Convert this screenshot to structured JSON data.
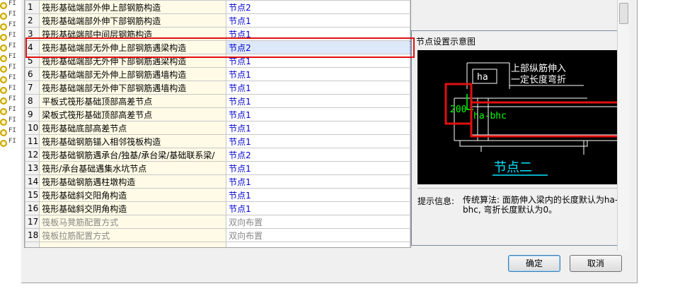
{
  "left_tree": {
    "items": [
      "FI",
      "FI",
      "FI",
      "FI",
      "FI",
      "FI",
      "FI",
      "FI",
      "FI",
      "FI",
      "FI",
      "FI",
      "FI",
      "FI"
    ]
  },
  "grid": {
    "rows": [
      {
        "num": "1",
        "name": "筏形基础端部外伸上部钢筋构造",
        "value": "节点2"
      },
      {
        "num": "2",
        "name": "筏形基础端部外伸下部钢筋构造",
        "value": "节点1"
      },
      {
        "num": "3",
        "name": "筏形基础端部中间层钢筋构造",
        "value": "节点1"
      },
      {
        "num": "4",
        "name": "筏形基础端部无外伸上部钢筋遇梁构造",
        "value": "节点2"
      },
      {
        "num": "5",
        "name": "筏形基础端部无外伸下部钢筋遇梁构造",
        "value": "节点1"
      },
      {
        "num": "6",
        "name": "筏形基础端部无外伸上部钢筋遇墙构造",
        "value": "节点1"
      },
      {
        "num": "7",
        "name": "筏形基础端部无外伸下部钢筋遇墙构造",
        "value": "节点1"
      },
      {
        "num": "8",
        "name": "平板式筏形基础顶部高差节点",
        "value": "节点1"
      },
      {
        "num": "9",
        "name": "梁板式筏形基础顶部高差节点",
        "value": "节点1"
      },
      {
        "num": "10",
        "name": "筏形基础底部高差节点",
        "value": "节点1"
      },
      {
        "num": "11",
        "name": "筏形基础钢筋锚入相邻筏板构造",
        "value": "节点1"
      },
      {
        "num": "12",
        "name": "筏形基础钢筋遇承台/独基/承台梁/基础联系梁/",
        "value": "节点2"
      },
      {
        "num": "13",
        "name": "筏形/承台基础遇集水坑节点",
        "value": "节点1"
      },
      {
        "num": "14",
        "name": "筏形基础钢筋遇柱墩构造",
        "value": "节点1"
      },
      {
        "num": "15",
        "name": "筏形基础斜交阳角构造",
        "value": "节点1"
      },
      {
        "num": "16",
        "name": "筏形基础斜交阴角构造",
        "value": "节点1"
      },
      {
        "num": "17",
        "name": "筏板马凳筋配置方式",
        "value": "双向布置"
      },
      {
        "num": "18",
        "name": "筏板拉筋配置方式",
        "value": "双向布置"
      }
    ]
  },
  "panel": {
    "title": "节点设置示意图",
    "diagram": {
      "label_ha": "ha",
      "label_top": "上部纵筋伸入",
      "label_top2": "一定长度弯折",
      "label_200": "200",
      "label_ha_bhc": "ha-bhc",
      "caption": "节点二"
    },
    "hint_label": "提示信息:",
    "hint_text": "传统算法: 面筋伸入梁内的长度默认为ha-bhc, 弯折长度默认为0。"
  },
  "buttons": {
    "ok": "确定",
    "cancel": "取消"
  },
  "colors": {
    "highlight_red": "#e01010",
    "diagram_bg": "#000000",
    "diagram_green": "#00ff00",
    "diagram_cyan": "#00e5ff",
    "value_blue": "#0000cc"
  }
}
